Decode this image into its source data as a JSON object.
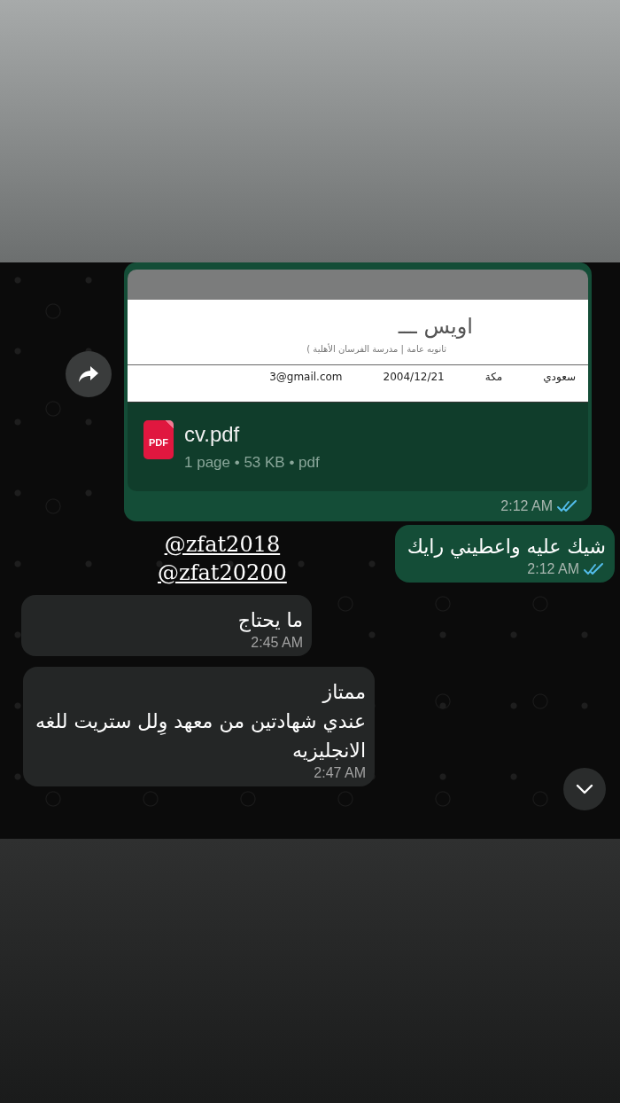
{
  "messages": [
    {
      "kind": "document",
      "outgoing": true,
      "preview": {
        "name": "اويس ـــ",
        "subtitle": "ثانويه عامة | مدرسة الفرسان الأهلية )",
        "fields": [
          "سعودي",
          "مكة",
          "2004/12/21",
          "3@gmail.com"
        ]
      },
      "file_badge": "PDF",
      "file_name": "cv.pdf",
      "meta": "1 page • 53 KB • pdf",
      "time": "2:12 AM",
      "read": true
    },
    {
      "kind": "text",
      "outgoing": true,
      "lines": [
        "شيك عليه واعطيني رايك"
      ],
      "time": "2:12 AM",
      "read": true
    },
    {
      "kind": "text",
      "outgoing": false,
      "lines": [
        "ما يحتاج"
      ],
      "time": "2:45 AM"
    },
    {
      "kind": "text",
      "outgoing": false,
      "lines": [
        "ممتاز",
        "عندي شهادتين من معهد وِلل ستريت للغه",
        "الانجليزيه"
      ],
      "time": "2:47 AM"
    }
  ],
  "overlay_text": [
    "@zfat2018",
    "@zfat20200"
  ]
}
